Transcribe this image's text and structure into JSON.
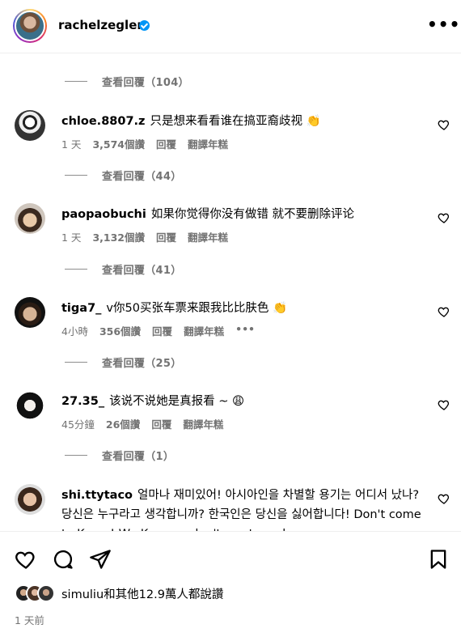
{
  "header": {
    "username": "rachelzegler",
    "verified": true,
    "more_icon": "more-horizontal-icon"
  },
  "comments": [
    {
      "replies_before": "查看回覆（104）",
      "username": "chloe.8807.z",
      "text": "只是想来看看谁在搞亚裔歧视",
      "emoji": "👏",
      "time": "1 天",
      "likes": "3,574個讚",
      "reply": "回覆",
      "translate": "翻譯年糕"
    },
    {
      "replies_before": "查看回覆（44）",
      "username": "paopaobuchi",
      "text": "如果你觉得你没有做错 就不要删除评论",
      "emoji": "",
      "time": "1 天",
      "likes": "3,132個讚",
      "reply": "回覆",
      "translate": "翻譯年糕"
    },
    {
      "replies_before": "查看回覆（41）",
      "username": "tiga7_",
      "text": "v你50买张车票来跟我比比肤色",
      "emoji": "👏",
      "time": "4小時",
      "likes": "356個讚",
      "reply": "回覆",
      "translate": "翻譯年糕",
      "extra": "•••"
    },
    {
      "replies_before": "查看回覆（25）",
      "username": "27.35_",
      "text": "该说不说她是真报看 ~",
      "emoji": "😩",
      "time": "45分鐘",
      "likes": "26個讚",
      "reply": "回覆",
      "translate": "翻譯年糕"
    },
    {
      "replies_before": "查看回覆（1）",
      "username": "shi.ttytaco",
      "text": "얼마나 재미있어! 아시아인을 차별할 용기는 어디서 났나? 당신은 누구라고 생각합니까? 한국인은 당신을 싫어합니다! Don't come to Korea! We Koreans don't want you here",
      "emoji": "",
      "time": "",
      "likes": "",
      "reply": "",
      "translate": ""
    }
  ],
  "footer": {
    "like_icon": "heart-outline-icon",
    "comment_icon": "comment-bubble-icon",
    "share_icon": "paper-plane-icon",
    "save_icon": "bookmark-icon",
    "likes_text": "simuliu和其他12.9萬人都說讚",
    "post_time": "1 天前"
  },
  "colors": {
    "secondary_text": "#737373",
    "verified_blue": "#0095f6",
    "divider": "#efefef"
  }
}
